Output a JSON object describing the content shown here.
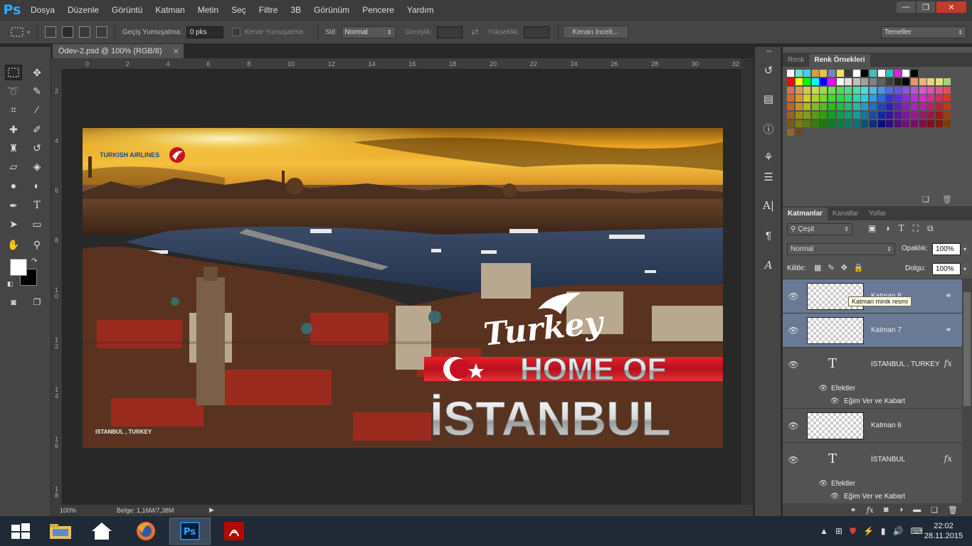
{
  "app": {
    "logo": "Ps",
    "menu": [
      "Dosya",
      "Düzenle",
      "Görüntü",
      "Katman",
      "Metin",
      "Seç",
      "Filtre",
      "3B",
      "Görünüm",
      "Pencere",
      "Yardım"
    ]
  },
  "window": {
    "minimize": "—",
    "restore": "❐",
    "close": "✕"
  },
  "options": {
    "feather_label": "Geçiş Yumuşatma:",
    "feather_value": "0 pks",
    "antialias_label": "Kenar Yumuşatma",
    "style_label": "Stil:",
    "style_value": "Normal",
    "width_label": "Genişlik:",
    "height_label": "Yükseklik:",
    "refine_button": "Kenarı İncelt...",
    "workspace": "Temeller"
  },
  "document": {
    "tab_title": "Ödev-2.psd @ 100% (RGB/8)",
    "close": "✕",
    "zoom": "100%",
    "doc_info": "Belge: 1,16M/7,38M"
  },
  "ruler": {
    "h_ticks": [
      "0",
      "2",
      "4",
      "6",
      "8",
      "10",
      "12",
      "14",
      "16",
      "18",
      "20",
      "22",
      "24",
      "26",
      "28",
      "30",
      "32"
    ],
    "v_ticks": [
      "2",
      "4",
      "6",
      "8",
      "1 0",
      "1 2",
      "1 4",
      "1 6",
      "1 8"
    ]
  },
  "artwork": {
    "airline": "TURKISH AIRLINES",
    "brand_script": "Turkey",
    "headline1": "HOME OF",
    "headline2": "İSTANBUL",
    "caption": "ISTANBUL , TURKEY"
  },
  "swatches_panel": {
    "tab_color": "Renk",
    "tab_swatches": "Renk Örnekleri"
  },
  "layers_panel": {
    "tabs": [
      "Katmanlar",
      "Kanallar",
      "Yollar"
    ],
    "filter": "Çeşit",
    "blend_mode": "Normal",
    "opacity_label": "Opaklık:",
    "opacity_value": "100%",
    "lock_label": "Kilitle:",
    "fill_label": "Dolgu:",
    "fill_value": "100%",
    "tooltip": "Katman minik resmi",
    "layers": [
      {
        "name": "Katman 8",
        "type": "pixel"
      },
      {
        "name": "Katman 7",
        "type": "pixel"
      },
      {
        "name": "ISTANBUL , TURKEY",
        "type": "text",
        "effects_label": "Efektler",
        "effect": "Eğim Ver ve Kabart"
      },
      {
        "name": "Katman 6",
        "type": "pixel"
      },
      {
        "name": "İSTANBUL",
        "type": "text",
        "effects_label": "Efektler",
        "effect": "Eğim Ver ve Kabart"
      }
    ]
  },
  "taskbar": {
    "time": "22:02",
    "date": "28.11.2015"
  },
  "colors": {
    "accent": "#31a8ff",
    "selected_layer": "#6a7a95",
    "swatches": [
      "#ff0000",
      "#ffff00",
      "#00ff00",
      "#00ffff",
      "#0000ff",
      "#ff00ff",
      "#ffffff",
      "#000000"
    ]
  }
}
